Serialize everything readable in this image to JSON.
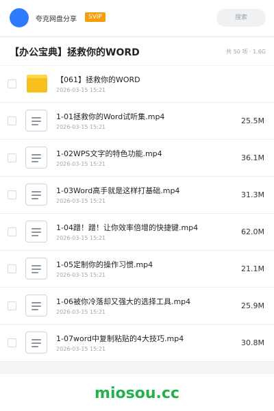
{
  "header": {
    "app_name": "夸克网盘分享",
    "badge": "SVIP",
    "search_placeholder": "搜索",
    "colors": {
      "avatar": "#2f7bff",
      "badge": "#f59e0b"
    }
  },
  "folder": {
    "title": "【办公宝典】拯救你的WORD",
    "meta": "共 50 项 · 1.6G"
  },
  "files": [
    {
      "type": "folder",
      "name": "【061】拯救你的WORD",
      "date": "2026-03-15 15:21",
      "size": ""
    },
    {
      "type": "file",
      "name": "1-01拯救你的Word试听集.mp4",
      "date": "2026-03-15 15:21",
      "size": "25.5M"
    },
    {
      "type": "file",
      "name": "1-02WPS文字的特色功能.mp4",
      "date": "2026-03-15 15:21",
      "size": "36.1M"
    },
    {
      "type": "file",
      "name": "1-03Word高手就是这样打基础.mp4",
      "date": "2026-03-15 15:21",
      "size": "31.3M"
    },
    {
      "type": "file",
      "name": "1-04蹭！蹭！让你效率倍增的快捷键.mp4",
      "date": "2026-03-15 15:21",
      "size": "62.0M"
    },
    {
      "type": "file",
      "name": "1-05定制你的操作习惯.mp4",
      "date": "2026-03-15 15:21",
      "size": "21.1M"
    },
    {
      "type": "file",
      "name": "1-06被你冷落却又强大的选择工具.mp4",
      "date": "2026-03-15 15:21",
      "size": "25.9M"
    },
    {
      "type": "file",
      "name": "1-07word中复制粘贴的4大技巧.mp4",
      "date": "2026-03-15 15:21",
      "size": "30.8M"
    }
  ],
  "footer": {
    "watermark": "miosou.cc",
    "color": "#22b14c"
  }
}
